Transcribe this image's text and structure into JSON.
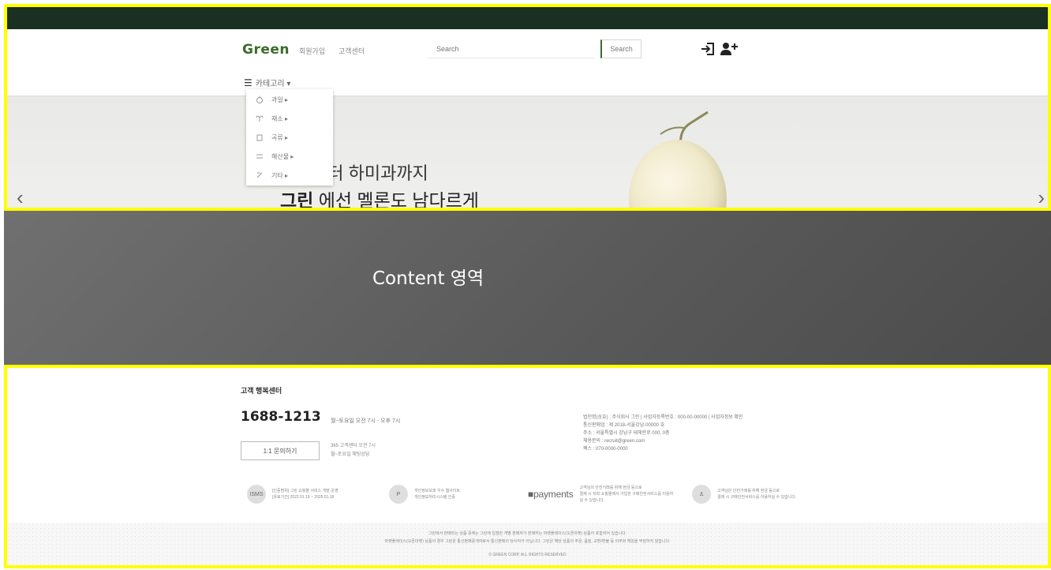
{
  "header": {
    "logo": "Green",
    "nav": [
      "회원가입",
      "고객센터"
    ],
    "search": {
      "placeholder": "Search",
      "button_label": "Search"
    },
    "category_toggle": "카테고리 ▾",
    "category_menu": [
      {
        "label": "과일 ▸",
        "icon": "fruit-icon"
      },
      {
        "label": "채소 ▸",
        "icon": "vegetable-icon"
      },
      {
        "label": "곡류 ▸",
        "icon": "grain-icon"
      },
      {
        "label": "해산물 ▸",
        "icon": "seafood-icon"
      },
      {
        "label": "기타 ▸",
        "icon": "etc-icon"
      }
    ],
    "icons": [
      "login-icon",
      "add-user-icon"
    ]
  },
  "hero": {
    "line1": "부터 하미과까지",
    "line2_bold": "그린",
    "line2_rest": " 에선 멜론도 남다르게",
    "prev_arrow": "‹",
    "next_arrow": "›"
  },
  "content": {
    "label": "Content 영역"
  },
  "footer": {
    "cs_title": "고객 행복센터",
    "phone": "1688-1213",
    "hours": "월~토요일 오전 7시 - 오후 7시",
    "inquiry_button": "1:1 문의하기",
    "inquiry_note": [
      "365 고객센터 오전 7시",
      "월~토요일 채팅상담"
    ],
    "company_info": [
      "법인명(상호) : 주식회사 그린 | 사업자등록번호 : 000-00-00000 | 사업자정보 확인",
      "통신판매업 : 제 2018-서울강남-00000 호",
      "주소 : 서울특별시 강남구 테헤란로 000, 0층",
      "채용문의 : recruit@green.com",
      "팩스 : 070-0000-0000"
    ],
    "certs": [
      {
        "badge": "ISMS",
        "text": [
          "[인증범위] 그린 쇼핑몰 서비스 개발·운영",
          "[유효기간] 2022.01.19 ~ 2025.01.18"
        ]
      },
      {
        "badge": "P",
        "text": [
          "개인정보보호 우수 웹사이트",
          "개인정보처리시스템 인증"
        ]
      },
      {
        "badge": "",
        "text": [
          "고객님의 안전거래를 위해 현금 등으로",
          "결제 시 저희 쇼핑몰에서 가입한 구매안전서비스를 이용하실 수 있습니다."
        ]
      },
      {
        "badge": "♙",
        "text": [
          "고객님은 안전거래를 위해 현금 등으로",
          "결제 시 구매안전서비스를 이용하실 수 있습니다."
        ]
      }
    ],
    "payments_logo": "payments",
    "bottom_lines": [
      "그린에서 판매되는 상품 중에는 그린에 입점한 개별 판매자가 판매하는 마켓플레이스(오픈마켓) 상품이 포함되어 있습니다.",
      "마켓플레이스(오픈마켓) 상품의 경우 그린은 통신판매중개자로서 통신판매의 당사자가 아닙니다. 그린은 해당 상품의 주문, 품질, 교환/환불 등 의무와 책임을 부담하지 않습니다.",
      "© GREEN CORP. ALL RIGHTS RESERVED"
    ]
  }
}
